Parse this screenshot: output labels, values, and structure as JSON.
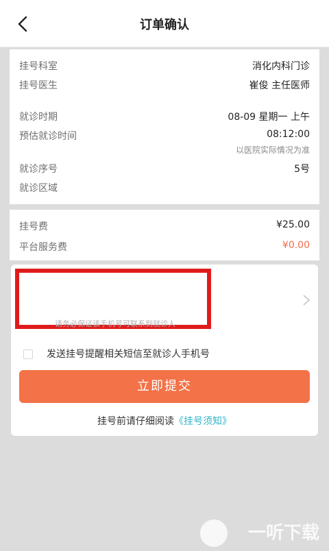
{
  "header": {
    "title": "订单确认"
  },
  "registration": {
    "dept_label": "挂号科室",
    "dept_value": "消化内科门诊",
    "doctor_label": "挂号医生",
    "doctor_value": "崔俊 主任医师"
  },
  "visit": {
    "date_label": "就诊时期",
    "date_value": "08-09 星期一 上午",
    "time_label": "预估就诊时间",
    "time_value": "08:12:00",
    "time_note": "以医院实际情况为准",
    "seq_label": "就诊序号",
    "seq_value": "5号",
    "area_label": "就诊区域",
    "area_value": ""
  },
  "fees": {
    "reg_fee_label": "挂号费",
    "reg_fee_value": "¥25.00",
    "service_fee_label": "平台服务费",
    "service_fee_value": "¥0.00"
  },
  "patient": {
    "phone_hint": "请务必保证该手机号可联系到就诊人"
  },
  "sms": {
    "label": "发送挂号提醒相关短信至就诊人手机号",
    "checked": false
  },
  "submit": {
    "label": "立即提交"
  },
  "notice": {
    "text": "挂号前请仔细阅读",
    "link": "《挂号须知》"
  },
  "watermark": {
    "text": "一听下载"
  },
  "colors": {
    "accent": "#f37247",
    "link": "#2fb6c8",
    "highlight_border": "#e01b1b"
  }
}
